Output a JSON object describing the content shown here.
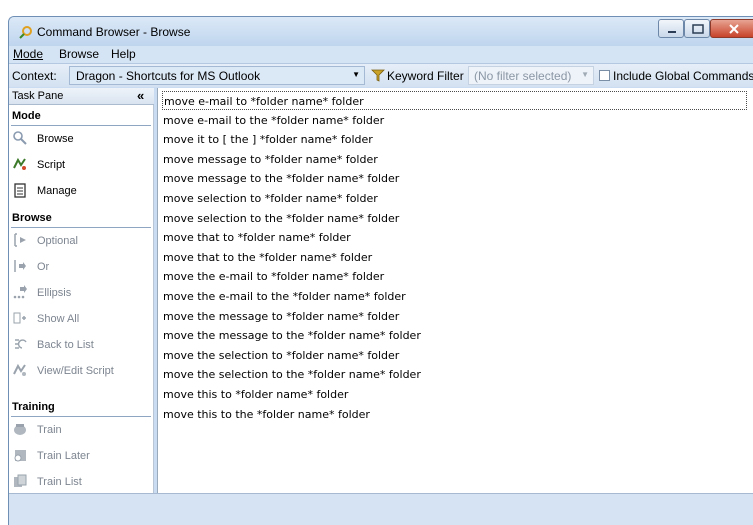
{
  "window": {
    "title": "Command Browser - Browse"
  },
  "menu": [
    {
      "label": "Mode"
    },
    {
      "label": "Browse"
    },
    {
      "label": "Help"
    }
  ],
  "toolbar": {
    "context_label": "Context:",
    "context_value": "Dragon - Shortcuts for MS Outlook",
    "keyword_filter_label": "Keyword Filter",
    "keyword_filter_value": "(No filter selected)",
    "include_global_label": "Include Global Commands",
    "include_global_checked": false
  },
  "task_pane": {
    "title": "Task Pane",
    "collapse_glyph": "«",
    "sections": [
      {
        "title": "Mode",
        "items": [
          {
            "label": "Browse",
            "icon": "magnifier-icon",
            "enabled": true
          },
          {
            "label": "Script",
            "icon": "script-icon",
            "enabled": true
          },
          {
            "label": "Manage",
            "icon": "manage-icon",
            "enabled": true
          }
        ]
      },
      {
        "title": "Browse",
        "items": [
          {
            "label": "Optional",
            "icon": "optional-icon",
            "enabled": false
          },
          {
            "label": "Or",
            "icon": "or-icon",
            "enabled": false
          },
          {
            "label": "Ellipsis",
            "icon": "ellipsis-icon",
            "enabled": false
          },
          {
            "label": "Show All",
            "icon": "show-all-icon",
            "enabled": false
          },
          {
            "label": "Back to List",
            "icon": "back-to-list-icon",
            "enabled": false
          },
          {
            "label": "View/Edit Script",
            "icon": "view-edit-script-icon",
            "enabled": false
          }
        ]
      },
      {
        "title": "Training",
        "items": [
          {
            "label": "Train",
            "icon": "train-icon",
            "enabled": false
          },
          {
            "label": "Train Later",
            "icon": "train-later-icon",
            "enabled": false
          },
          {
            "label": "Train List",
            "icon": "train-list-icon",
            "enabled": false
          }
        ]
      }
    ]
  },
  "commands": [
    "move e-mail to *folder name* folder",
    "move e-mail to the *folder name* folder",
    "move it to [ the ] *folder name* folder",
    "move message to *folder name* folder",
    "move message to the *folder name* folder",
    "move selection to *folder name* folder",
    "move selection to the *folder name* folder",
    "move that to *folder name* folder",
    "move that to the *folder name* folder",
    "move the e-mail to *folder name* folder",
    "move the e-mail to the *folder name* folder",
    "move the message to *folder name* folder",
    "move the message to the *folder name* folder",
    "move the selection to *folder name* folder",
    "move the selection to the *folder name* folder",
    "move this to *folder name* folder",
    "move this to the *folder name* folder"
  ],
  "selected_command_index": 0
}
